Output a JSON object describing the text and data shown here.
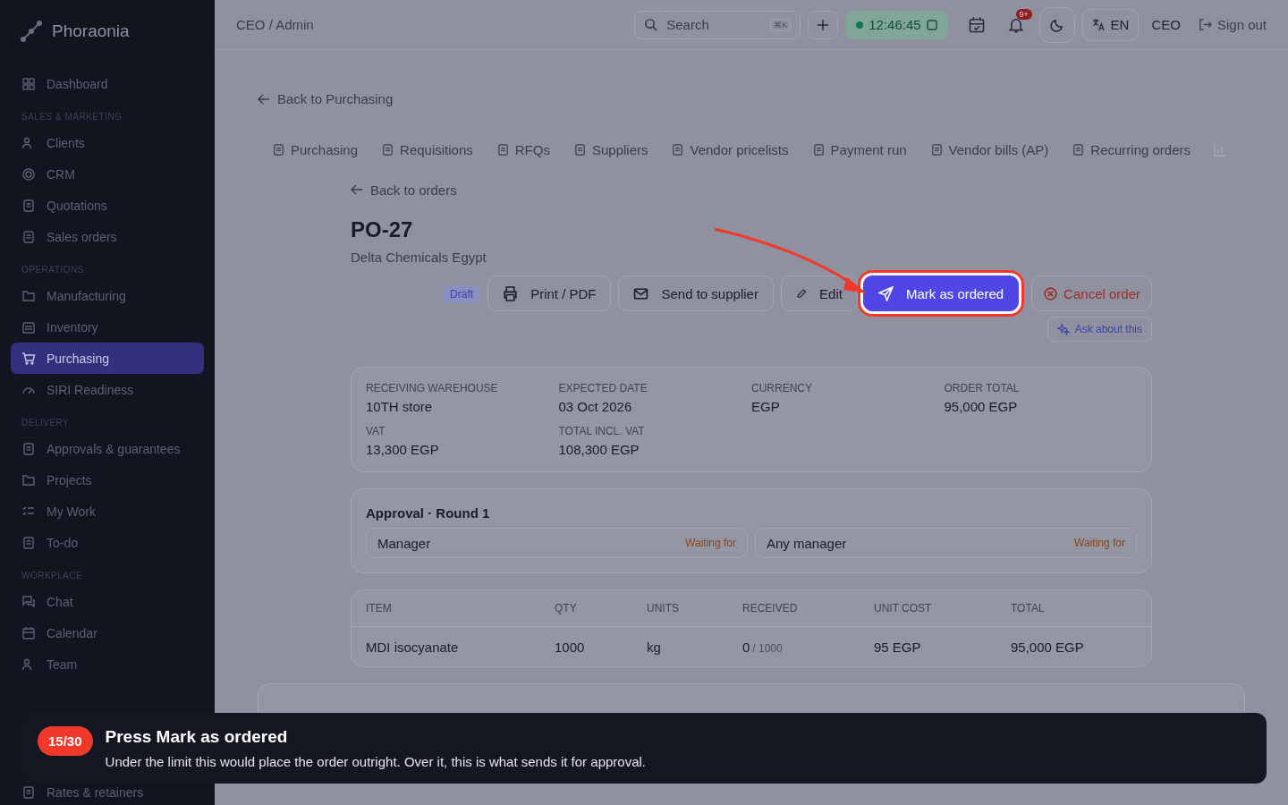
{
  "app": {
    "name": "Phoraonia"
  },
  "sidebar": {
    "sections": [
      {
        "items": [
          {
            "label": "Dashboard",
            "selected": false
          }
        ]
      },
      {
        "heading": "SALES & MARKETING",
        "items": [
          {
            "label": "Clients",
            "selected": false
          },
          {
            "label": "CRM",
            "selected": false
          },
          {
            "label": "Quotations",
            "selected": false
          },
          {
            "label": "Sales orders",
            "selected": false
          }
        ]
      },
      {
        "heading": "OPERATIONS",
        "items": [
          {
            "label": "Manufacturing",
            "selected": false
          },
          {
            "label": "Inventory",
            "selected": false
          },
          {
            "label": "Purchasing",
            "selected": true
          },
          {
            "label": "SIRI Readiness",
            "selected": false
          }
        ]
      },
      {
        "heading": "DELIVERY",
        "items": [
          {
            "label": "Approvals & guarantees",
            "selected": false
          },
          {
            "label": "Projects",
            "selected": false
          },
          {
            "label": "My Work",
            "selected": false
          },
          {
            "label": "To-do",
            "selected": false
          }
        ]
      },
      {
        "heading": "WORKPLACE",
        "items": [
          {
            "label": "Chat",
            "selected": false
          },
          {
            "label": "Calendar",
            "selected": false
          },
          {
            "label": "Team",
            "selected": false
          },
          {
            "label": "Rates & retainers",
            "selected": false
          }
        ]
      }
    ]
  },
  "topbar": {
    "breadcrumb": "CEO / Admin",
    "search": {
      "placeholder": "Search",
      "shortcut": "⌘K"
    },
    "clock": "12:46:45",
    "notifications_badge": "9+",
    "language": "EN",
    "user": "CEO",
    "sign_out": "Sign out"
  },
  "back_link": "Back to Purchasing",
  "tabs": [
    {
      "label": "Purchasing"
    },
    {
      "label": "Requisitions"
    },
    {
      "label": "RFQs"
    },
    {
      "label": "Suppliers"
    },
    {
      "label": "Vendor pricelists"
    },
    {
      "label": "Payment run"
    },
    {
      "label": "Vendor bills (AP)"
    },
    {
      "label": "Recurring orders"
    }
  ],
  "order": {
    "back_link": "Back to orders",
    "title": "PO-27",
    "supplier": "Delta Chemicals Egypt",
    "status": "Draft",
    "actions": [
      {
        "kind": "print",
        "label": "Print / PDF"
      },
      {
        "kind": "mail",
        "label": "Send to supplier"
      },
      {
        "kind": "edit",
        "label": "Edit"
      },
      {
        "kind": "primary",
        "label": "Mark as ordered",
        "highlighted": true
      },
      {
        "kind": "danger",
        "label": "Cancel order"
      }
    ],
    "ask": "Ask about this",
    "fields": [
      {
        "label": "RECEIVING WAREHOUSE",
        "value": "10TH store"
      },
      {
        "label": "EXPECTED DATE",
        "value": "03 Oct 2026"
      },
      {
        "label": "CURRENCY",
        "value": "EGP"
      },
      {
        "label": "ORDER TOTAL",
        "value": "95,000 EGP"
      },
      {
        "label": "VAT",
        "value": "13,300 EGP"
      },
      {
        "label": "TOTAL INCL. VAT",
        "value": "108,300 EGP"
      }
    ],
    "approval": {
      "title": "Approval · Round 1",
      "steps": [
        {
          "approver": "Manager",
          "status": "Waiting for"
        },
        {
          "approver": "Any manager",
          "status": "Waiting for"
        }
      ]
    },
    "table": {
      "columns": [
        "ITEM",
        "QTY",
        "UNITS",
        "RECEIVED",
        "UNIT COST",
        "TOTAL"
      ],
      "rows": [
        {
          "item": "MDI isocyanate",
          "qty": "1000",
          "units": "kg",
          "received": "0",
          "received_of": "/ 1000",
          "unit_cost": "95 EGP",
          "total": "95,000 EGP"
        }
      ]
    }
  },
  "tour": {
    "step": "15/30",
    "title": "Press Mark as ordered",
    "text": "Under the limit this would place the order outright. Over it, this is what sends it for approval."
  }
}
